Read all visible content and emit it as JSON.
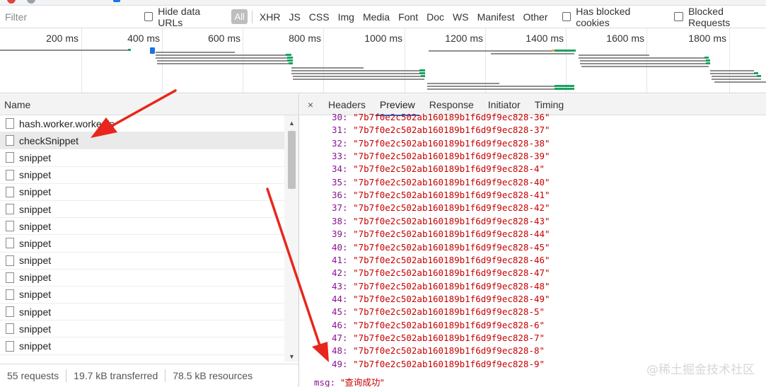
{
  "filter": {
    "placeholder": "Filter",
    "hide_data_urls": "Hide data URLs",
    "all": "All",
    "types": [
      "XHR",
      "JS",
      "CSS",
      "Img",
      "Media",
      "Font",
      "Doc",
      "WS",
      "Manifest",
      "Other"
    ],
    "has_blocked_cookies": "Has blocked cookies",
    "blocked_requests": "Blocked Requests"
  },
  "overview": {
    "ticks": [
      "200 ms",
      "400 ms",
      "600 ms",
      "800 ms",
      "1000 ms",
      "1200 ms",
      "1400 ms",
      "1600 ms",
      "1800 ms"
    ]
  },
  "requests": {
    "header": "Name",
    "rows": [
      "hash.worker.worker.js",
      "checkSnippet",
      "snippet",
      "snippet",
      "snippet",
      "snippet",
      "snippet",
      "snippet",
      "snippet",
      "snippet",
      "snippet",
      "snippet",
      "snippet",
      "snippet"
    ],
    "selected_index": 1
  },
  "status": {
    "requests": "55 requests",
    "transferred": "19.7 kB transferred",
    "resources": "78.5 kB resources"
  },
  "detail": {
    "close": "×",
    "tabs": [
      "Headers",
      "Preview",
      "Response",
      "Initiator",
      "Timing"
    ],
    "active_tab": "Preview",
    "preview_lines": [
      {
        "k": "30:",
        "v": "\"7b7f0e2c502ab160189b1f6d9f9ec828-36\""
      },
      {
        "k": "31:",
        "v": "\"7b7f0e2c502ab160189b1f6d9f9ec828-37\""
      },
      {
        "k": "32:",
        "v": "\"7b7f0e2c502ab160189b1f6d9f9ec828-38\""
      },
      {
        "k": "33:",
        "v": "\"7b7f0e2c502ab160189b1f6d9f9ec828-39\""
      },
      {
        "k": "34:",
        "v": "\"7b7f0e2c502ab160189b1f6d9f9ec828-4\""
      },
      {
        "k": "35:",
        "v": "\"7b7f0e2c502ab160189b1f6d9f9ec828-40\""
      },
      {
        "k": "36:",
        "v": "\"7b7f0e2c502ab160189b1f6d9f9ec828-41\""
      },
      {
        "k": "37:",
        "v": "\"7b7f0e2c502ab160189b1f6d9f9ec828-42\""
      },
      {
        "k": "38:",
        "v": "\"7b7f0e2c502ab160189b1f6d9f9ec828-43\""
      },
      {
        "k": "39:",
        "v": "\"7b7f0e2c502ab160189b1f6d9f9ec828-44\""
      },
      {
        "k": "40:",
        "v": "\"7b7f0e2c502ab160189b1f6d9f9ec828-45\""
      },
      {
        "k": "41:",
        "v": "\"7b7f0e2c502ab160189b1f6d9f9ec828-46\""
      },
      {
        "k": "42:",
        "v": "\"7b7f0e2c502ab160189b1f6d9f9ec828-47\""
      },
      {
        "k": "43:",
        "v": "\"7b7f0e2c502ab160189b1f6d9f9ec828-48\""
      },
      {
        "k": "44:",
        "v": "\"7b7f0e2c502ab160189b1f6d9f9ec828-49\""
      },
      {
        "k": "45:",
        "v": "\"7b7f0e2c502ab160189b1f6d9f9ec828-5\""
      },
      {
        "k": "46:",
        "v": "\"7b7f0e2c502ab160189b1f6d9f9ec828-6\""
      },
      {
        "k": "47:",
        "v": "\"7b7f0e2c502ab160189b1f6d9f9ec828-7\""
      },
      {
        "k": "48:",
        "v": "\"7b7f0e2c502ab160189b1f6d9f9ec828-8\""
      },
      {
        "k": "49:",
        "v": "\"7b7f0e2c502ab160189b1f6d9f9ec828-9\""
      }
    ],
    "msg_key": "msg:",
    "msg_value": "\"查询成功\""
  },
  "watermark": "@稀土掘金技术社区",
  "colors": {
    "accent": "#1a73e8",
    "key": "#881391",
    "string": "#c80000",
    "arrow": "#e8261d",
    "bar_green": "#1aa260"
  }
}
